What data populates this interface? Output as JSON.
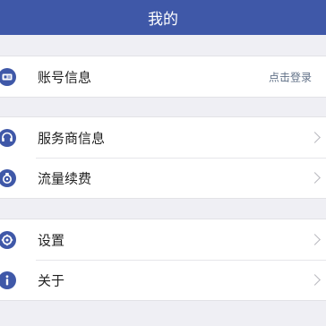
{
  "header": {
    "title": "我的"
  },
  "groups": [
    {
      "rows": [
        {
          "label": "账号信息",
          "right_text": "点击登录",
          "icon": "account-card-icon"
        }
      ]
    },
    {
      "rows": [
        {
          "label": "服务商信息",
          "icon": "headset-icon"
        },
        {
          "label": "流量续费",
          "icon": "renew-icon"
        }
      ]
    },
    {
      "rows": [
        {
          "label": "设置",
          "icon": "gear-icon"
        },
        {
          "label": "关于",
          "icon": "info-icon"
        }
      ]
    }
  ],
  "colors": {
    "header_bg": "#3f58a8",
    "icon_blue": "#3f58a8",
    "page_bg": "#efeff4"
  }
}
